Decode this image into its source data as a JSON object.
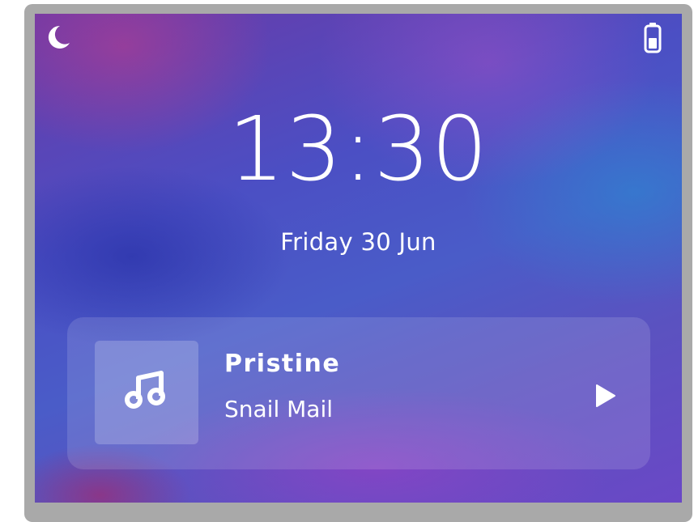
{
  "status_bar": {
    "left_icon": "moon-icon",
    "right_icon": "battery-icon"
  },
  "lock_screen": {
    "time": "13:30",
    "date": "Friday 30 Jun"
  },
  "media_player": {
    "artwork_icon": "music-note-icon",
    "track_title": "Pristine",
    "artist": "Snail Mail",
    "control_icon": "play-icon"
  },
  "colors": {
    "text": "#ffffff",
    "frame": "#a9a9a9",
    "wallpaper_base": "#4b4fc4"
  }
}
